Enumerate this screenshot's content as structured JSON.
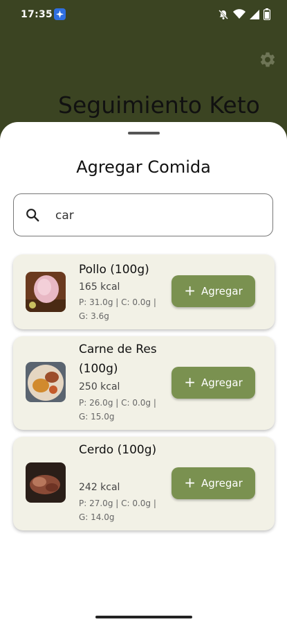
{
  "status": {
    "time": "17:35"
  },
  "app": {
    "title": "Seguimiento Keto"
  },
  "sheet": {
    "title": "Agregar Comida"
  },
  "search": {
    "value": "car"
  },
  "foods": [
    {
      "name": "Pollo (100g)",
      "kcal": "165 kcal",
      "macros": "P: 31.0g | C: 0.0g | G: 3.6g",
      "button": "Agregar"
    },
    {
      "name": "Carne de Res (100g)",
      "kcal": "250 kcal",
      "macros": "P: 26.0g | C: 0.0g | G: 15.0g",
      "button": "Agregar"
    },
    {
      "name": "Cerdo (100g)",
      "kcal": "242 kcal",
      "macros": "P: 27.0g | C: 0.0g | G: 14.0g",
      "button": "Agregar"
    }
  ],
  "icons": [
    "gear-icon",
    "search-icon",
    "plus-icon",
    "wifi-icon",
    "signal-icon",
    "battery-icon",
    "mute-icon"
  ]
}
